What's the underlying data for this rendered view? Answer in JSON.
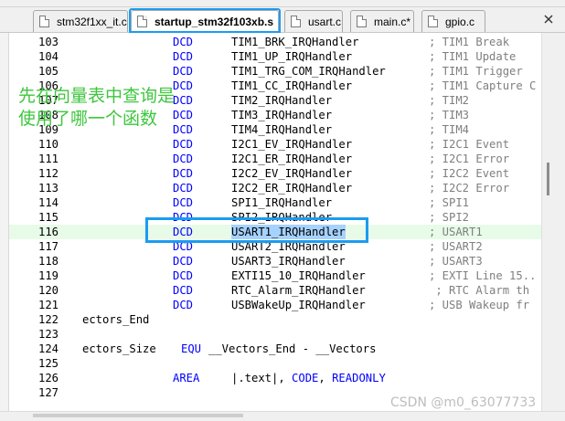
{
  "tabs": [
    {
      "label": "stm32f1xx_it.c",
      "active": false
    },
    {
      "label": "startup_stm32f103xb.s",
      "active": true
    },
    {
      "label": "usart.c",
      "active": false
    },
    {
      "label": "main.c*",
      "active": false
    },
    {
      "label": "gpio.c",
      "active": false
    }
  ],
  "annotation": {
    "line1": "先在向量表中查询是",
    "line2": "使用了哪一个函数"
  },
  "lines": [
    {
      "num": "103",
      "op": "DCD",
      "arg": "TIM1_BRK_IRQHandler",
      "comment": "; TIM1 Break"
    },
    {
      "num": "104",
      "op": "DCD",
      "arg": "TIM1_UP_IRQHandler",
      "comment": "; TIM1 Update"
    },
    {
      "num": "105",
      "op": "DCD",
      "arg": "TIM1_TRG_COM_IRQHandler",
      "comment": "; TIM1 Trigger"
    },
    {
      "num": "106",
      "op": "DCD",
      "arg": "TIM1_CC_IRQHandler",
      "comment": "; TIM1 Capture C"
    },
    {
      "num": "107",
      "op": "DCD",
      "arg": "TIM2_IRQHandler",
      "comment": "; TIM2"
    },
    {
      "num": "108",
      "op": "DCD",
      "arg": "TIM3_IRQHandler",
      "comment": "; TIM3"
    },
    {
      "num": "109",
      "op": "DCD",
      "arg": "TIM4_IRQHandler",
      "comment": "; TIM4"
    },
    {
      "num": "110",
      "op": "DCD",
      "arg": "I2C1_EV_IRQHandler",
      "comment": "; I2C1 Event"
    },
    {
      "num": "111",
      "op": "DCD",
      "arg": "I2C1_ER_IRQHandler",
      "comment": "; I2C1 Error"
    },
    {
      "num": "112",
      "op": "DCD",
      "arg": "I2C2_EV_IRQHandler",
      "comment": "; I2C2 Event"
    },
    {
      "num": "113",
      "op": "DCD",
      "arg": "I2C2_ER_IRQHandler",
      "comment": "; I2C2 Error"
    },
    {
      "num": "114",
      "op": "DCD",
      "arg": "SPI1_IRQHandler",
      "comment": "; SPI1"
    },
    {
      "num": "115",
      "op": "DCD",
      "arg": "SPI2_IRQHandler",
      "comment": "; SPI2"
    },
    {
      "num": "116",
      "op": "DCD",
      "arg": "USART1_IRQHandler",
      "comment": "; USART1"
    },
    {
      "num": "117",
      "op": "DCD",
      "arg": "USART2_IRQHandler",
      "comment": "; USART2"
    },
    {
      "num": "118",
      "op": "DCD",
      "arg": "USART3_IRQHandler",
      "comment": "; USART3"
    },
    {
      "num": "119",
      "op": "DCD",
      "arg": "EXTI15_10_IRQHandler",
      "comment": "; EXTI Line 15.."
    },
    {
      "num": "120",
      "op": "DCD",
      "arg": "RTC_Alarm_IRQHandler",
      "comment": " ; RTC Alarm th"
    },
    {
      "num": "121",
      "op": "DCD",
      "arg": "USBWakeUp_IRQHandler",
      "comment": "; USB Wakeup fr"
    },
    {
      "num": "122",
      "text": "ectors_End"
    },
    {
      "num": "123",
      "text": ""
    },
    {
      "num": "124",
      "text": "ectors_Size",
      "op": "EQU",
      "arg": "__Vectors_End - __Vectors"
    },
    {
      "num": "125",
      "text": ""
    },
    {
      "num": "126",
      "op": "AREA",
      "arg": "|.text|, CODE, READONLY"
    },
    {
      "num": "127",
      "text": ""
    }
  ],
  "watermark": "CSDN @m0_63077733",
  "colors": {
    "keyword": "#0000ff",
    "comment": "#7f7f7f",
    "annotation": "#3ec63e",
    "callout": "#1a9cf0",
    "current_line": "#e8fbe8",
    "selection": "#a6d2ff"
  }
}
